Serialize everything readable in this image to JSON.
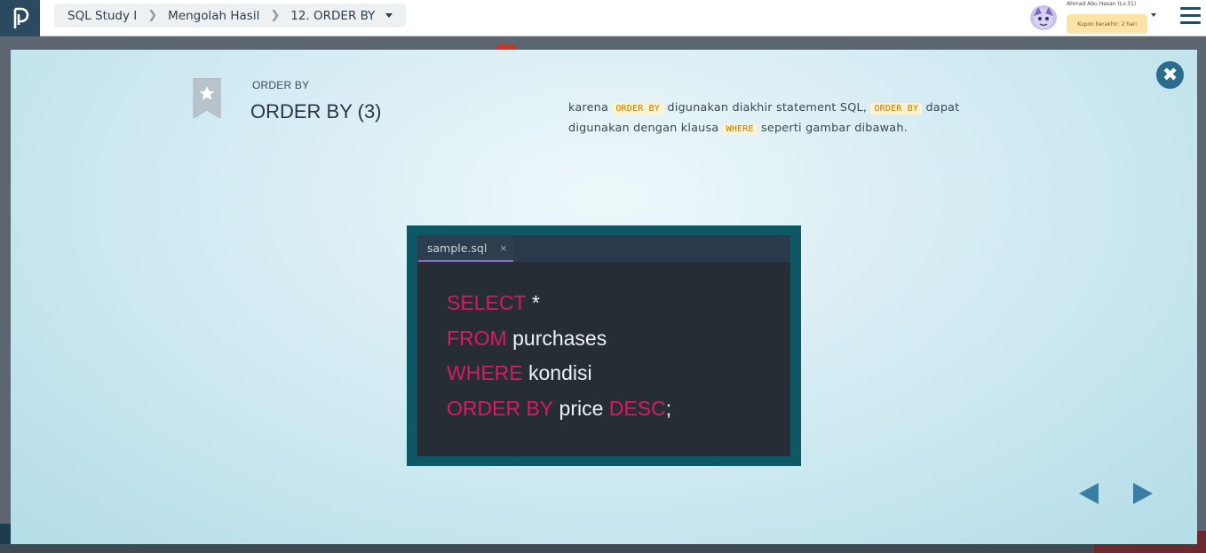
{
  "header": {
    "breadcrumb": [
      {
        "label": "SQL Study I"
      },
      {
        "label": "Mengolah Hasil"
      },
      {
        "label": "12. ORDER BY"
      }
    ],
    "user": {
      "name": "Ahmad Abu Hasan (Lv.31)",
      "coupon": "Kupon berakhir: 2 hari"
    },
    "icons": {
      "logo": "progate-logo-icon",
      "menu": "hamburger-menu-icon"
    }
  },
  "lesson": {
    "kicker": "ORDER BY",
    "title": "ORDER BY (3)",
    "text": {
      "t1": "karena",
      "k1": "ORDER BY",
      "t2": "digunakan diakhir statement SQL,",
      "k2": "ORDER BY",
      "t3": "dapat digunakan dengan klausa",
      "k3": "WHERE",
      "t4": "seperti gambar dibawah."
    }
  },
  "editor": {
    "tab_label": "sample.sql",
    "tab_close": "×",
    "lines": [
      {
        "kw": "SELECT",
        "rest": "*"
      },
      {
        "kw": "FROM",
        "rest": "purchases"
      },
      {
        "kw": "WHERE",
        "rest": "kondisi"
      },
      {
        "kw": "ORDER BY",
        "rest": "price",
        "kw2": "DESC",
        "tail": ";"
      }
    ]
  },
  "controls": {
    "close": "✖",
    "prev": "previous-slide",
    "next": "next-slide"
  },
  "colors": {
    "sql_keyword": "#d81b60",
    "inline_keyword": "#c47a00",
    "accent": "#2b6b8e"
  }
}
